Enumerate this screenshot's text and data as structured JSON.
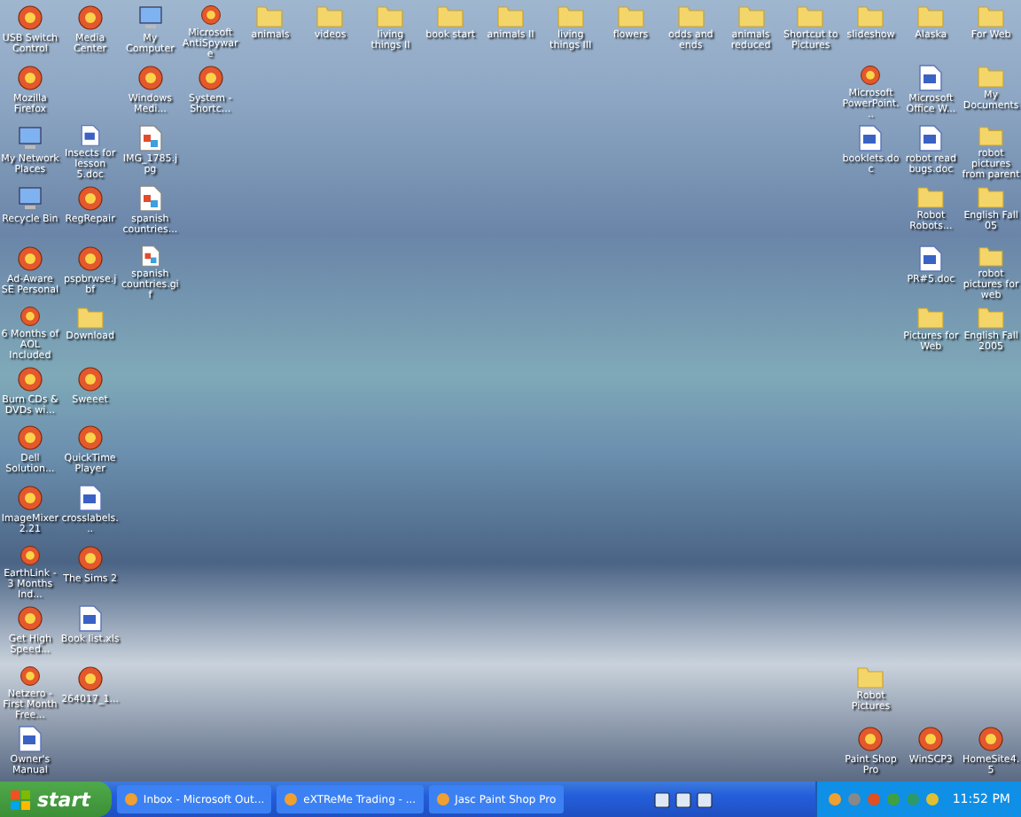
{
  "desktop_icons": [
    {
      "label": "USB Switch Control",
      "kind": "program"
    },
    {
      "label": "Media Center",
      "kind": "program"
    },
    {
      "label": "My Computer",
      "kind": "system"
    },
    {
      "label": "Microsoft AntiSpyware",
      "kind": "program"
    },
    {
      "label": "animals",
      "kind": "folder"
    },
    {
      "label": "videos",
      "kind": "folder"
    },
    {
      "label": "living things II",
      "kind": "folder"
    },
    {
      "label": "book start",
      "kind": "folder"
    },
    {
      "label": "animals II",
      "kind": "folder"
    },
    {
      "label": "living things III",
      "kind": "folder"
    },
    {
      "label": "flowers",
      "kind": "folder"
    },
    {
      "label": "odds and ends",
      "kind": "folder"
    },
    {
      "label": "animals reduced",
      "kind": "folder"
    },
    {
      "label": "Shortcut to Pictures",
      "kind": "folder"
    },
    {
      "label": "slideshow",
      "kind": "folder"
    },
    {
      "label": "Alaska",
      "kind": "folder"
    },
    {
      "label": "For Web",
      "kind": "folder"
    },
    {
      "label": "Mozilla Firefox",
      "kind": "program"
    },
    {
      "label": "Windows Medi...",
      "kind": "program"
    },
    {
      "label": "System - Shortc...",
      "kind": "program"
    },
    {
      "label": "Microsoft PowerPoint...",
      "kind": "program"
    },
    {
      "label": "Microsoft Office W...",
      "kind": "document"
    },
    {
      "label": "My Documents",
      "kind": "folder"
    },
    {
      "label": "My Network Places",
      "kind": "system"
    },
    {
      "label": "Insects for lesson 5.doc",
      "kind": "document"
    },
    {
      "label": "IMG_1785.jpg",
      "kind": "image"
    },
    {
      "label": "booklets.doc",
      "kind": "document"
    },
    {
      "label": "robot read bugs.doc",
      "kind": "document"
    },
    {
      "label": "robot pictures from parent",
      "kind": "folder"
    },
    {
      "label": "Recycle Bin",
      "kind": "system"
    },
    {
      "label": "RegRepair",
      "kind": "program"
    },
    {
      "label": "spanish countries...",
      "kind": "image"
    },
    {
      "label": "Robot Robots...",
      "kind": "folder"
    },
    {
      "label": "English Fall 05",
      "kind": "folder"
    },
    {
      "label": "Ad-Aware SE Personal",
      "kind": "program"
    },
    {
      "label": "pspbrwse.jbf",
      "kind": "program"
    },
    {
      "label": "spanish countries.gif",
      "kind": "image"
    },
    {
      "label": "PR#5.doc",
      "kind": "document"
    },
    {
      "label": "robot pictures for web",
      "kind": "folder"
    },
    {
      "label": "6 Months of AOL Included",
      "kind": "program"
    },
    {
      "label": "Download",
      "kind": "folder"
    },
    {
      "label": "Pictures for Web",
      "kind": "folder"
    },
    {
      "label": "English Fall 2005",
      "kind": "folder"
    },
    {
      "label": "Burn CDs & DVDs wi...",
      "kind": "program"
    },
    {
      "label": "Sweeet",
      "kind": "program"
    },
    {
      "label": "Dell Solution...",
      "kind": "program"
    },
    {
      "label": "QuickTime Player",
      "kind": "program"
    },
    {
      "label": "ImageMixer 2.21",
      "kind": "program"
    },
    {
      "label": "crosslabels...",
      "kind": "document"
    },
    {
      "label": "EarthLink - 3 Months Ind...",
      "kind": "program"
    },
    {
      "label": "The Sims 2",
      "kind": "program"
    },
    {
      "label": "Get High Speed...",
      "kind": "program"
    },
    {
      "label": "Book list.xls",
      "kind": "document"
    },
    {
      "label": "Netzero - First Month Free...",
      "kind": "program"
    },
    {
      "label": "264017_1...",
      "kind": "program"
    },
    {
      "label": "Robot Pictures",
      "kind": "folder"
    },
    {
      "label": "Owner's Manual",
      "kind": "document"
    },
    {
      "label": "Paint Shop Pro",
      "kind": "program"
    },
    {
      "label": "WinSCP3",
      "kind": "program"
    },
    {
      "label": "HomeSite4.5",
      "kind": "program"
    }
  ],
  "taskbar": {
    "start": "start",
    "tasks": [
      {
        "label": "Inbox - Microsoft Out...",
        "selected": false
      },
      {
        "label": "eXTReMe Trading - ...",
        "selected": false
      },
      {
        "label": "Jasc Paint Shop Pro",
        "selected": false
      }
    ],
    "clock": "11:52 PM"
  }
}
